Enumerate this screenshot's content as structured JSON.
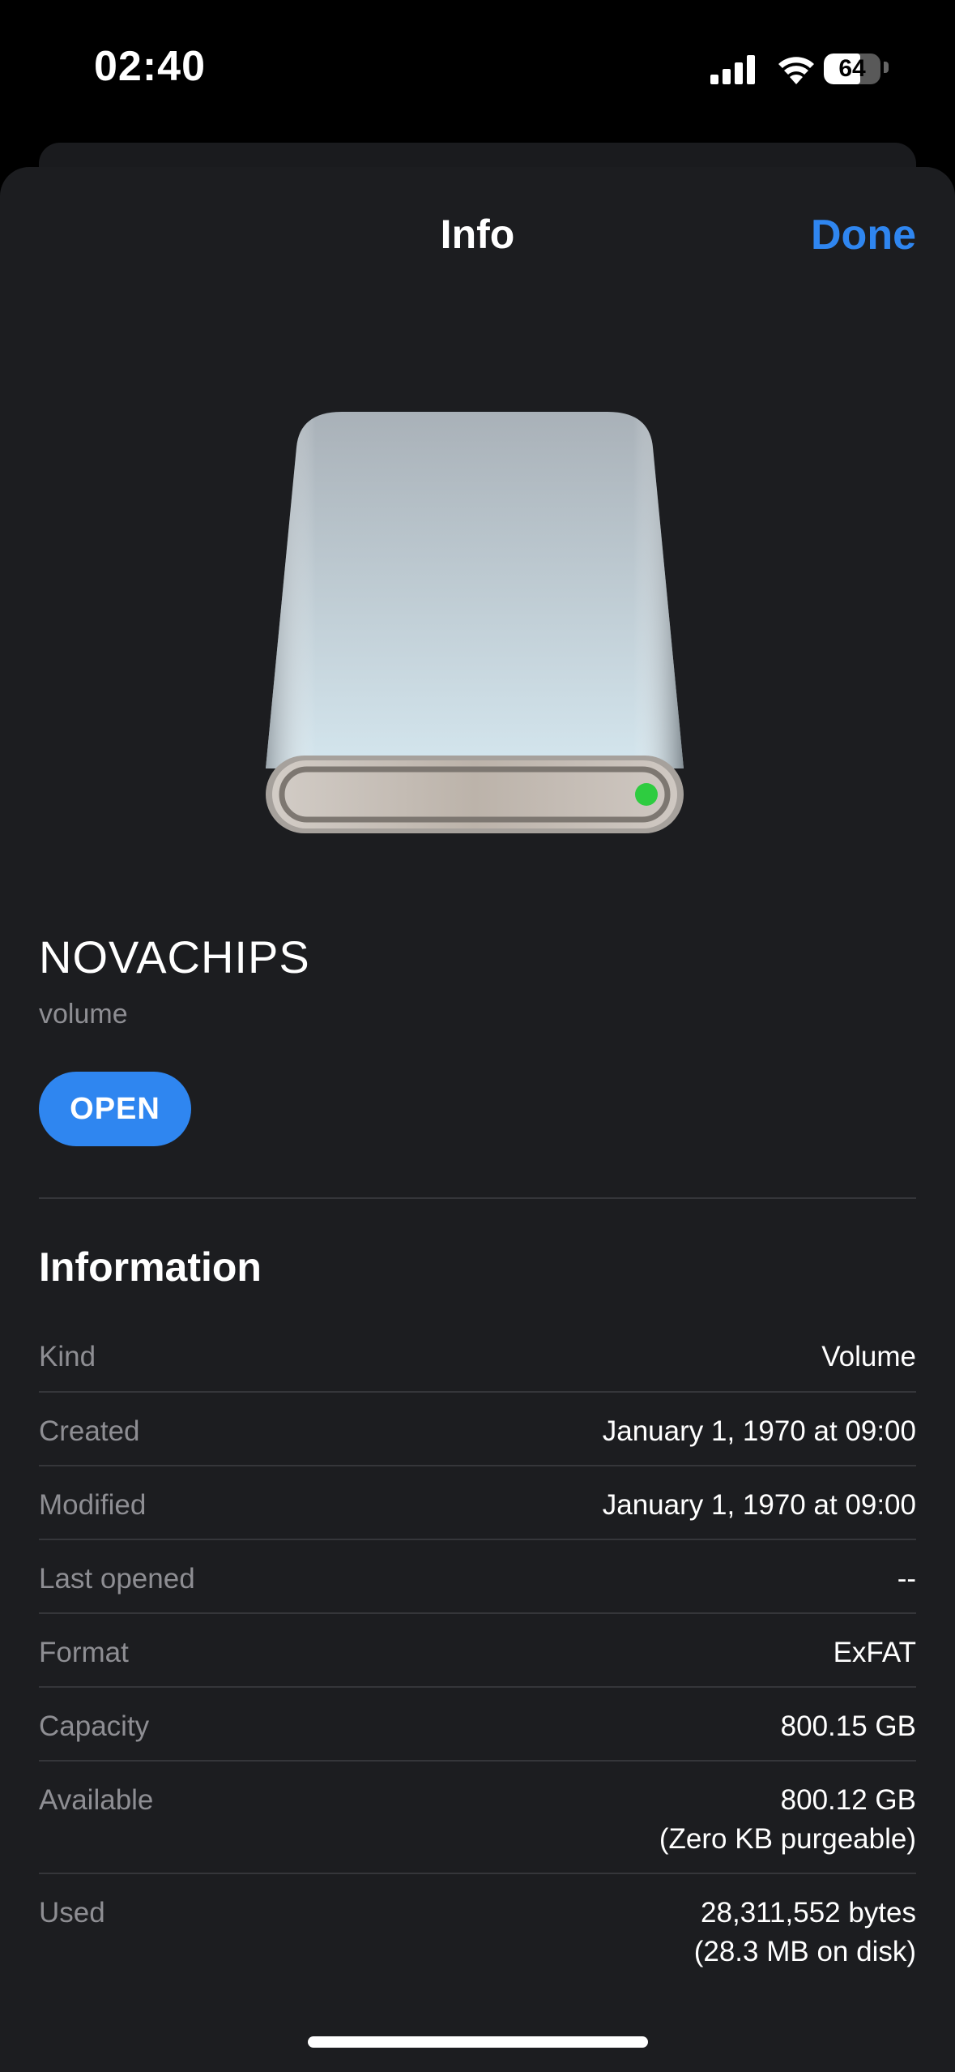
{
  "status_bar": {
    "time": "02:40",
    "battery_level": "64",
    "battery_fraction": 0.64
  },
  "sheet": {
    "title": "Info",
    "done_label": "Done"
  },
  "item": {
    "name": "NOVACHIPS",
    "kind": "volume",
    "open_label": "OPEN",
    "icon": "external-drive-icon",
    "status_led_color": "#2ecc40"
  },
  "information": {
    "title": "Information",
    "rows": [
      {
        "label": "Kind",
        "value": "Volume"
      },
      {
        "label": "Created",
        "value": "January 1, 1970 at 09:00"
      },
      {
        "label": "Modified",
        "value": "January 1, 1970 at 09:00"
      },
      {
        "label": "Last opened",
        "value": "--"
      },
      {
        "label": "Format",
        "value": "ExFAT"
      },
      {
        "label": "Capacity",
        "value": "800.15 GB"
      },
      {
        "label": "Available",
        "value": "800.12 GB",
        "detail": "(Zero KB purgeable)"
      },
      {
        "label": "Used",
        "value": "28,311,552 bytes",
        "detail": "(28.3 MB on disk)"
      }
    ]
  },
  "colors": {
    "accent": "#2f86f0",
    "background": "#1c1d20",
    "secondary_text": "#8e8e93"
  }
}
